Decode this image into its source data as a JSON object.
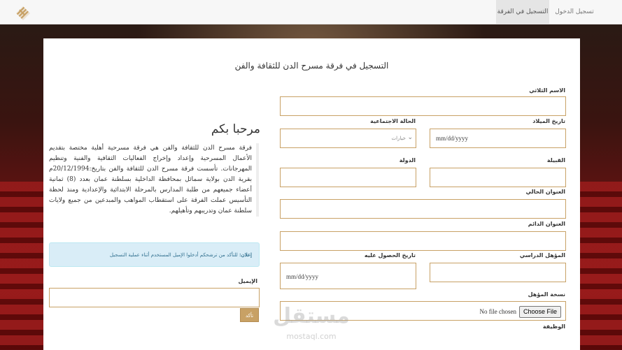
{
  "navbar": {
    "logo_icon": "diamond-stripes-logo-icon",
    "items": [
      {
        "label": "التسجيل في الفرقة",
        "active": true
      },
      {
        "label": "تسجيل الدخول",
        "active": false
      }
    ]
  },
  "form": {
    "title": "التسجيل في فرقة مسرح الدن للثقافة والفن",
    "full_name": {
      "label": "الاسم الثلاثي",
      "value": ""
    },
    "birth_date": {
      "label": "تاريخ الميلاد",
      "placeholder": "mm/dd/yyyy"
    },
    "marital_status": {
      "label": "الحالة الاجتماعية",
      "selected": "خيارات"
    },
    "tribe": {
      "label": "القبيلة",
      "value": ""
    },
    "country": {
      "label": "الدولة",
      "value": ""
    },
    "current_address": {
      "label": "العنوان الحالي",
      "value": ""
    },
    "permanent_address": {
      "label": "العنوان الدائم",
      "value": ""
    },
    "qualification": {
      "label": "المؤهل الدراسي",
      "value": ""
    },
    "qualification_date": {
      "label": "تاريخ الحصول عليه",
      "placeholder": "mm/dd/yyyy"
    },
    "qualification_copy": {
      "label": "نسخة المؤهل",
      "file_status": "No file chosen",
      "button": "Choose File"
    },
    "job": {
      "label": "الوظيفة"
    }
  },
  "left": {
    "welcome": "مرحبا بكم",
    "intro": "فرقة مسرح الدن للثقافة والفن هي فرقة مسرحية أهلية مختصة بتقديم الأعمال المسرحية وإعداد وإخراج الفعاليات الثقافية والفنية وتنظيم المهرجانات. تأسست فرقة مسرح الدن للثقافة والفن بتاريخ:20/12/1994م بقرية الدن بولاية سمائل بمحافظة الداخلية بسلطنة عمان بعدد (8) ثمانية أعضاء جميعهم من طلبة المدارس بالمرحلة الابتدائية والإعدادية ومنذ لحظة التأسيس عملت الفرقة على استقطاب المواهب والمبدعين من جميع ولايات سلطنة عمان وتدريبهم وتأهيلهم.",
    "notice_strong": "إعلان:",
    "notice_text": "للتأكد من ترشحكم أدخلوا الإميل المستخدم أثناء عملية التسجيل",
    "email_label": "الإيميل",
    "confirm_button": "تأكد"
  },
  "watermark": {
    "main": "مستقل",
    "sub": "mostaql.com"
  }
}
